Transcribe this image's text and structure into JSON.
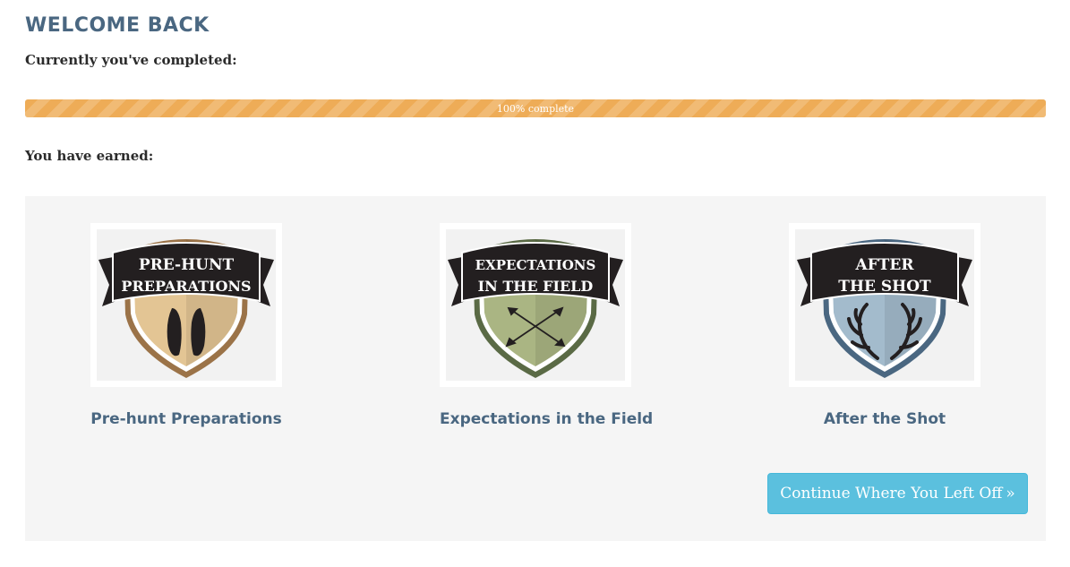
{
  "header": {
    "title": "WELCOME BACK",
    "completed_label": "Currently you've completed:",
    "earned_label": "You have earned:"
  },
  "progress": {
    "percent": 100,
    "label": "100% complete",
    "color": "#eeac57"
  },
  "badges": [
    {
      "caption": "Pre-hunt Preparations",
      "banner_line1": "PRE-HUNT",
      "banner_line2": "PREPARATIONS",
      "icon": "hoof-prints-icon",
      "color": "#e3c594",
      "border_color": "#9b7348"
    },
    {
      "caption": "Expectations in the Field",
      "banner_line1": "EXPECTATIONS",
      "banner_line2": "IN THE FIELD",
      "icon": "crossed-arrows-icon",
      "color": "#aab583",
      "border_color": "#5a6a45"
    },
    {
      "caption": "After the Shot",
      "banner_line1": "AFTER",
      "banner_line2": "THE SHOT",
      "icon": "antlers-icon",
      "color": "#a3bbcc",
      "border_color": "#4a6781"
    }
  ],
  "continue_button": {
    "label": "Continue Where You Left Off",
    "icon": "double-chevron-right-icon"
  },
  "colors": {
    "heading": "#4a6781",
    "button": "#5bc0de",
    "panel": "#f5f5f5"
  }
}
